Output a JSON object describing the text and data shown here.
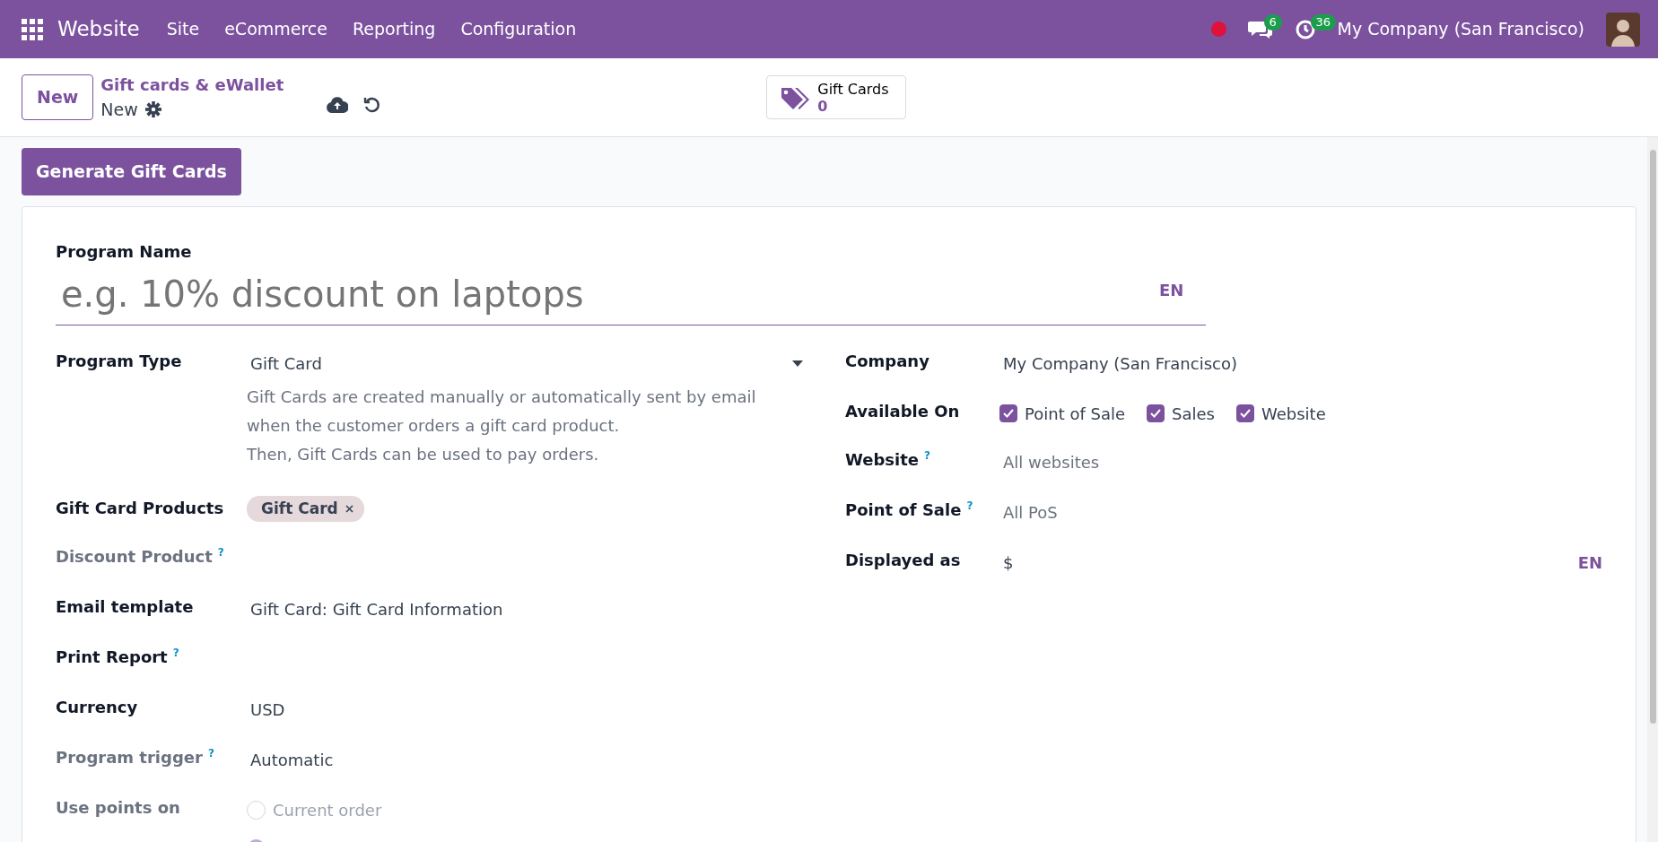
{
  "navbar": {
    "app_name": "Website",
    "menu": [
      "Site",
      "eCommerce",
      "Reporting",
      "Configuration"
    ],
    "messages_count": "6",
    "activities_count": "36",
    "company": "My Company (San Francisco)"
  },
  "control_panel": {
    "new_button": "New",
    "breadcrumb": "Gift cards & eWallet",
    "record": "New",
    "smart_button": {
      "label": "Gift Cards",
      "value": "0"
    }
  },
  "generate_button": "Generate Gift Cards",
  "form": {
    "program_name": {
      "label": "Program Name",
      "placeholder": "e.g. 10% discount on laptops",
      "lang": "EN"
    },
    "left_fields": [
      {
        "kind": "select",
        "label": "Program Type",
        "muted": false,
        "value": "Gift Card",
        "description": [
          "Gift Cards are created manually or automatically sent by email when the customer orders a gift card product.",
          "Then, Gift Cards can be used to pay orders."
        ]
      },
      {
        "kind": "tags",
        "label": "Gift Card Products",
        "muted": false,
        "tags": [
          "Gift Card"
        ]
      },
      {
        "kind": "text",
        "label": "Discount Product",
        "muted": true,
        "help": "?"
      },
      {
        "kind": "text",
        "label": "Email template",
        "muted": false,
        "value": "Gift Card: Gift Card Information"
      },
      {
        "kind": "text",
        "label": "Print Report",
        "muted": false,
        "help": "?"
      },
      {
        "kind": "text",
        "label": "Currency",
        "muted": false,
        "value": "USD"
      },
      {
        "kind": "text",
        "label": "Program trigger",
        "muted": true,
        "help": "?",
        "value": "Automatic"
      },
      {
        "kind": "radio",
        "label": "Use points on",
        "muted": true,
        "options": [
          {
            "label": "Current order",
            "selected": false
          },
          {
            "selected": true
          }
        ]
      }
    ],
    "right_fields": [
      {
        "kind": "text",
        "label": "Company",
        "value": "My Company (San Francisco)"
      },
      {
        "kind": "checks",
        "label": "Available On",
        "options": [
          {
            "label": "Point of Sale",
            "checked": true
          },
          {
            "label": "Sales",
            "checked": true
          },
          {
            "label": "Website",
            "checked": true
          }
        ]
      },
      {
        "kind": "text",
        "label": "Website",
        "help": "?",
        "placeholder": "All websites"
      },
      {
        "kind": "text",
        "label": "Point of Sale",
        "help": "?",
        "placeholder": "All PoS"
      },
      {
        "kind": "text",
        "label": "Displayed as",
        "value": "$",
        "lang": "EN"
      }
    ]
  }
}
